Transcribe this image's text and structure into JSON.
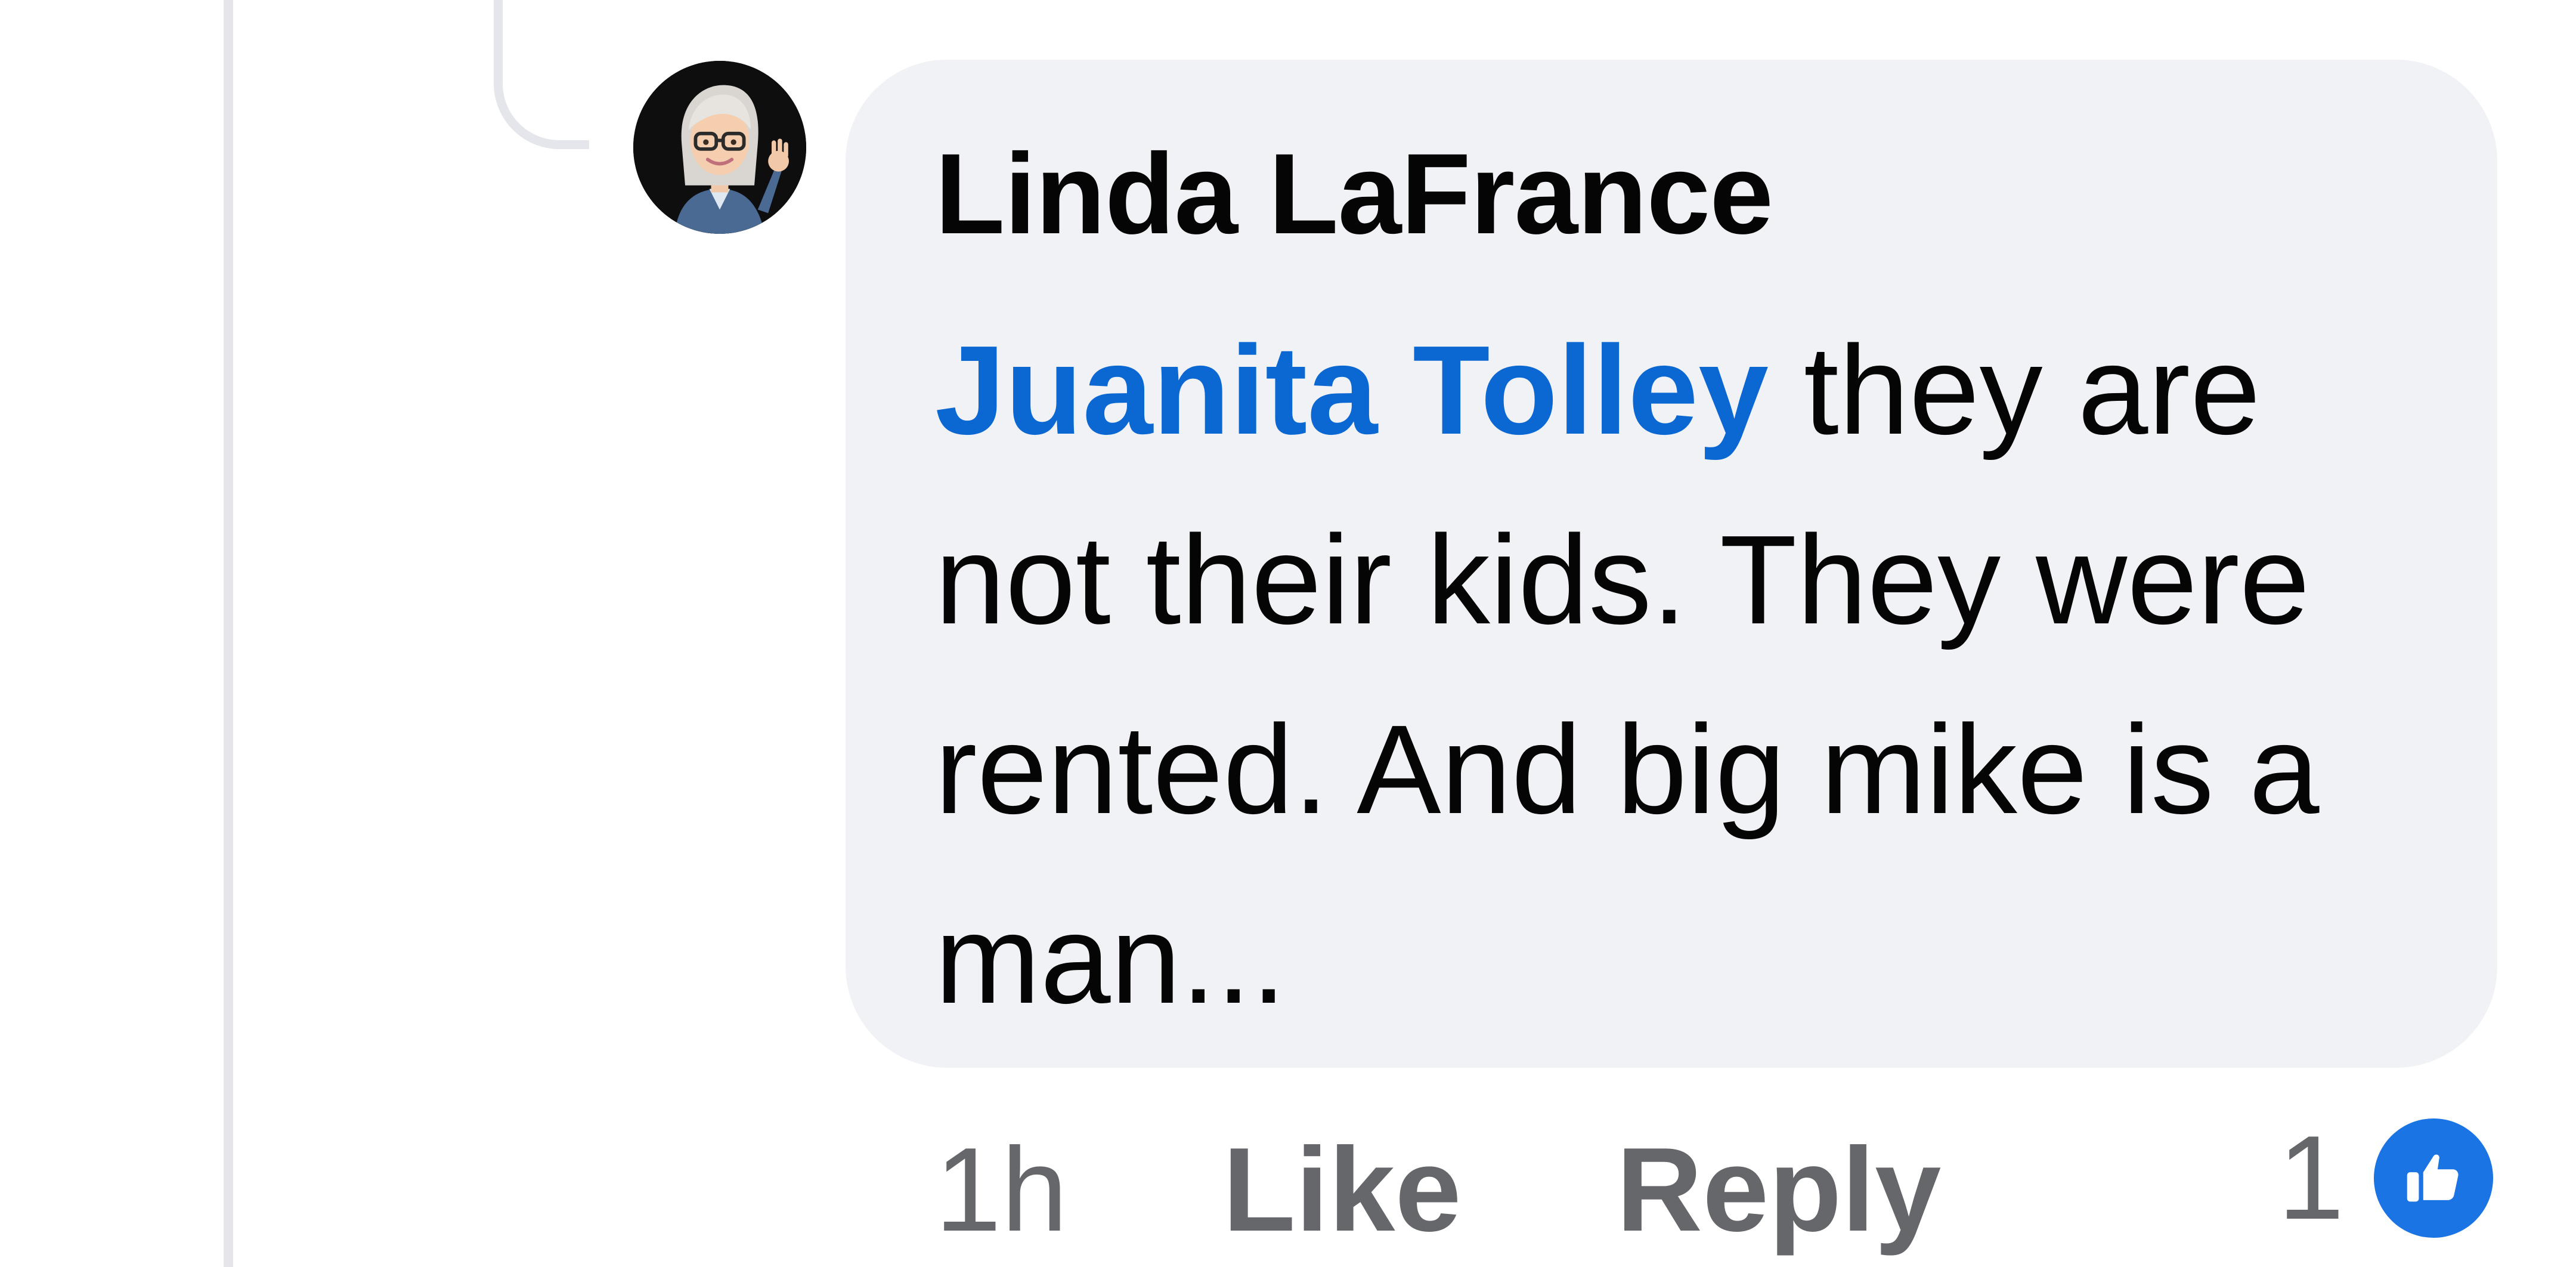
{
  "comment": {
    "author": "Linda LaFrance",
    "mention": "Juanita Tolley",
    "text": " they are not their kids. They were rented. And big mike is a man...",
    "avatar_icon": "avatar-memoji-icon"
  },
  "actions": {
    "timestamp": "1h",
    "like_label": "Like",
    "reply_label": "Reply"
  },
  "reactions": {
    "count": "1",
    "icon": "thumbs-up-icon",
    "icon_color": "#1b74e4"
  },
  "colors": {
    "bubble_background": "#f0f2f5",
    "mention_link": "#0b68d2",
    "secondary_text": "#65676b",
    "thread_line": "#e4e6eb"
  }
}
